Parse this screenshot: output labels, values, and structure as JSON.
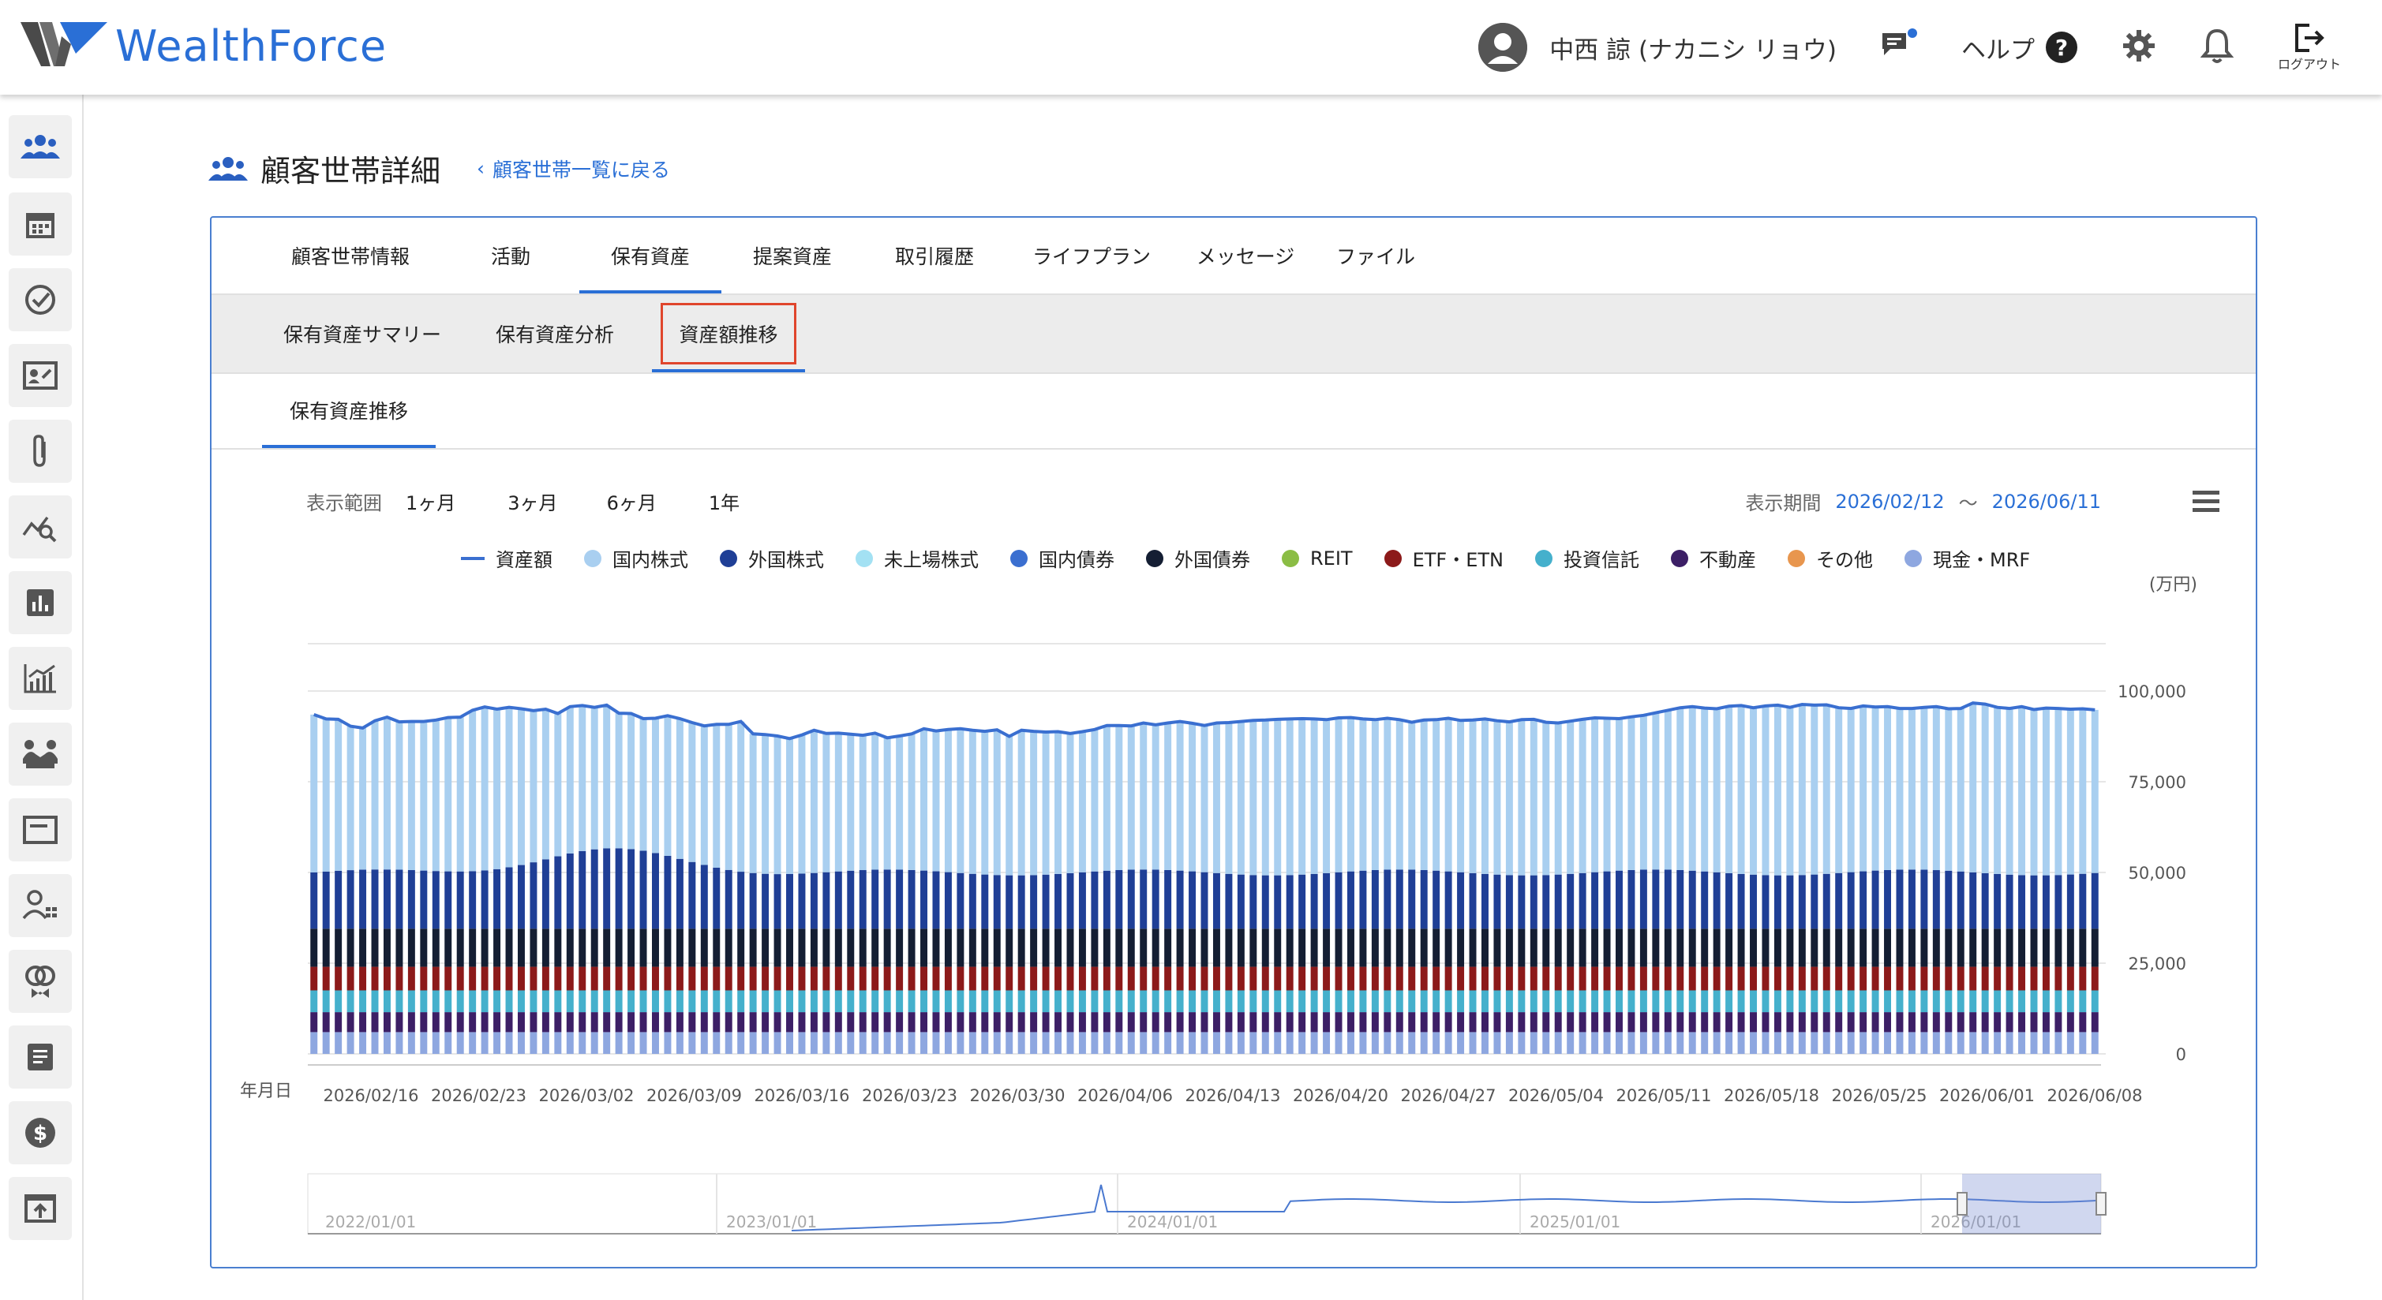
{
  "app": {
    "name": "WealthForce"
  },
  "header": {
    "user_name": "中西 諒 (ナカニシ リョウ)",
    "help_label": "ヘルプ",
    "help_q": "?",
    "logout_label": "ログアウト",
    "icons": [
      "user-avatar-icon",
      "chat-icon",
      "gear-icon",
      "bell-icon",
      "logout-icon"
    ]
  },
  "sidebar": {
    "icons": [
      "households-icon",
      "calendar-icon",
      "check-circle-icon",
      "contact-card-icon",
      "attachment-icon",
      "chart-search-icon",
      "bar-chart-icon",
      "growth-chart-icon",
      "meeting-icon",
      "window-icon",
      "user-list-icon",
      "rings-icon",
      "document-icon",
      "dollar-icon",
      "upload-icon"
    ]
  },
  "page": {
    "title": "顧客世帯詳細",
    "back_link": "顧客世帯一覧に戻る"
  },
  "tabs_main": [
    {
      "label": "顧客世帯情報",
      "active": false
    },
    {
      "label": "活動",
      "active": false
    },
    {
      "label": "保有資産",
      "active": true
    },
    {
      "label": "提案資産",
      "active": false
    },
    {
      "label": "取引履歴",
      "active": false
    },
    {
      "label": "ライフプラン",
      "active": false
    },
    {
      "label": "メッセージ",
      "active": false
    },
    {
      "label": "ファイル",
      "active": false
    }
  ],
  "tabs_sub": [
    {
      "label": "保有資産サマリー",
      "active": false
    },
    {
      "label": "保有資産分析",
      "active": false
    },
    {
      "label": "資産額推移",
      "active": true
    }
  ],
  "tabs_third": [
    {
      "label": "保有資産推移",
      "active": true
    }
  ],
  "range": {
    "label": "表示範囲",
    "options": [
      "1ヶ月",
      "3ヶ月",
      "6ヶ月",
      "1年"
    ],
    "period_label": "表示期間",
    "period_start": "2026/02/12",
    "period_sep": "〜",
    "period_end": "2026/06/11"
  },
  "chart_data": {
    "type": "bar",
    "stacked": true,
    "unit_label": "(万円)",
    "xlabel": "年月日",
    "ylim": [
      0,
      110000
    ],
    "yticks": [
      0,
      25000,
      50000,
      75000,
      100000
    ],
    "ytick_labels": [
      "0",
      "25,000",
      "50,000",
      "75,000",
      "100,000"
    ],
    "x_tick_labels": [
      "2026/02/16",
      "2026/02/23",
      "2026/03/02",
      "2026/03/09",
      "2026/03/16",
      "2026/03/23",
      "2026/03/30",
      "2026/04/06",
      "2026/04/13",
      "2026/04/20",
      "2026/04/27",
      "2026/05/04",
      "2026/05/11",
      "2026/05/18",
      "2026/05/25",
      "2026/06/01",
      "2026/06/08"
    ],
    "legend": [
      {
        "name": "資産額",
        "color": "#3a6fd0",
        "marker": "line"
      },
      {
        "name": "国内株式",
        "color": "#a9cff0",
        "marker": "dot"
      },
      {
        "name": "外国株式",
        "color": "#1f3f96",
        "marker": "dot"
      },
      {
        "name": "未上場株式",
        "color": "#a3e1f3",
        "marker": "dot"
      },
      {
        "name": "国内債券",
        "color": "#3b6fd0",
        "marker": "dot"
      },
      {
        "name": "外国債券",
        "color": "#141e33",
        "marker": "dot"
      },
      {
        "name": "REIT",
        "color": "#8bbd45",
        "marker": "dot"
      },
      {
        "name": "ETF・ETN",
        "color": "#8c1a1a",
        "marker": "dot"
      },
      {
        "name": "投資信託",
        "color": "#45b0cc",
        "marker": "dot"
      },
      {
        "name": "不動産",
        "color": "#3c1f66",
        "marker": "dot"
      },
      {
        "name": "その他",
        "color": "#e8964e",
        "marker": "dot"
      },
      {
        "name": "現金・MRF",
        "color": "#8ea7e0",
        "marker": "dot"
      }
    ],
    "stack_values_approx": {
      "現金・MRF": 6000,
      "不動産": 5500,
      "投資信託": 6000,
      "ETF・ETN": 6500,
      "外国債券": 10500,
      "外国株式_range": [
        15500,
        22000
      ],
      "国内株式_range": [
        37000,
        44000
      ]
    },
    "total_series": [
      93500,
      92300,
      92200,
      90300,
      89800,
      91800,
      92800,
      91500,
      91600,
      91600,
      92000,
      92700,
      92800,
      94700,
      95600,
      95000,
      95500,
      95100,
      94600,
      95000,
      93800,
      95700,
      96000,
      95500,
      96100,
      93900,
      93800,
      92400,
      92500,
      93200,
      92400,
      91300,
      90400,
      90800,
      90800,
      91600,
      88200,
      88000,
      87600,
      86900,
      87900,
      89200,
      88300,
      88400,
      88100,
      87800,
      88400,
      87100,
      87600,
      88200,
      89600,
      89000,
      89400,
      89600,
      89200,
      88900,
      89300,
      87500,
      89200,
      88900,
      88700,
      88800,
      88300,
      88800,
      89400,
      90500,
      90500,
      90400,
      91200,
      90700,
      91200,
      91600,
      91100,
      90500,
      91200,
      91300,
      91600,
      91900,
      92000,
      92200,
      92300,
      92400,
      92300,
      92100,
      92600,
      92700,
      92300,
      92100,
      92500,
      92100,
      91400,
      92000,
      92100,
      92500,
      91900,
      92000,
      92300,
      91800,
      91500,
      92100,
      92200,
      91400,
      91200,
      91700,
      92200,
      92600,
      92500,
      92400,
      92900,
      93300,
      94000,
      94700,
      95400,
      95700,
      95300,
      95100,
      95800,
      96000,
      95400,
      95900,
      96100,
      95500,
      96300,
      96100,
      96200,
      95400,
      95200,
      95900,
      95600,
      95700,
      95200,
      95200,
      95500,
      95700,
      95100,
      95200,
      96700,
      96400,
      95500,
      95200,
      95700,
      94900,
      95300,
      95200,
      95000,
      95100,
      94800
    ],
    "navigator": {
      "labels": [
        "2022/01/01",
        "2023/01/01",
        "2024/01/01",
        "2025/01/01",
        "2026/01/01"
      ]
    }
  }
}
